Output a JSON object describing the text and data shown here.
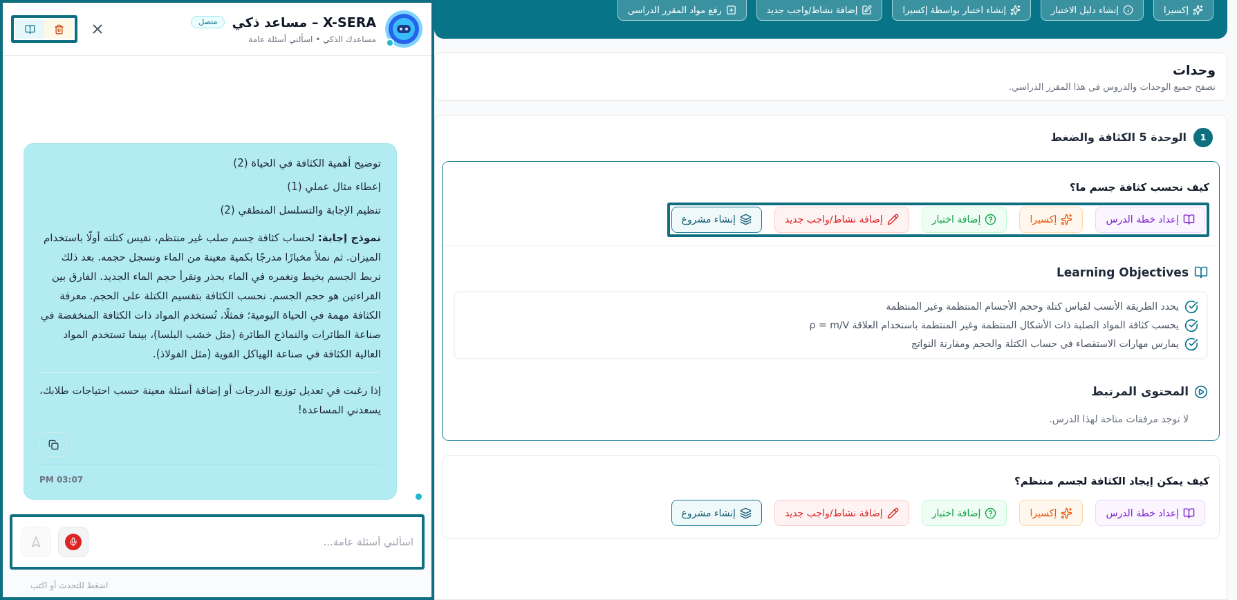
{
  "top_actions": [
    {
      "kind": "xsera",
      "label": "إكسيرا"
    },
    {
      "kind": "guide",
      "label": "إنشاء دليل الاختبار"
    },
    {
      "kind": "ai_quiz",
      "label": "إنشاء اختبار بواسطة إكسيرا"
    },
    {
      "kind": "activity",
      "label": "إضافة نشاط/واجب جديد"
    },
    {
      "kind": "upload",
      "label": "رفع مواد المقرر الدراسي"
    }
  ],
  "units_header": {
    "title": "وحدات",
    "subtitle": "تصفح جميع الوحدات والدروس في هذا المقرر الدراسي."
  },
  "unit": {
    "number": "1",
    "title": "الوحدة 5 الكثافة والضغط",
    "lessons": [
      {
        "title": "كيف نحسب كثافة جسم ما؟",
        "expanded": true,
        "actions": [
          {
            "kind": "plan",
            "label": "إعداد خطة الدرس"
          },
          {
            "kind": "xsera",
            "label": "إكسيرا"
          },
          {
            "kind": "quiz",
            "label": "إضافة اختبار"
          },
          {
            "kind": "activity",
            "label": "إضافة نشاط/واجب جديد"
          },
          {
            "kind": "project",
            "label": "إنشاء مشروع"
          }
        ],
        "objectives": {
          "title": "Learning Objectives",
          "items": [
            "يحدد الطريقة الأنسب لقياس كتلة وحجم الأجسام المنتظمة وغير المنتظمة",
            "يحسب كثافة المواد الصلبة ذات الأشكال المنتظمة وغير المنتظمة باستخدام العلاقة ρ = m/V",
            "يمارس مهارات الاستقصاء في حساب الكتلة والحجم ومقارنة النواتج"
          ]
        },
        "related": {
          "title": "المحتوى المرتبط",
          "empty": "لا توجد مرفقات متاحة لهذا الدرس."
        }
      },
      {
        "title": "كيف يمكن إيجاد الكثافة لجسم منتظم؟",
        "expanded": false,
        "actions": [
          {
            "kind": "plan",
            "label": "إعداد خطة الدرس"
          },
          {
            "kind": "xsera",
            "label": "إكسيرا"
          },
          {
            "kind": "quiz",
            "label": "إضافة اختبار"
          },
          {
            "kind": "activity",
            "label": "إضافة نشاط/واجب جديد"
          },
          {
            "kind": "project",
            "label": "إنشاء مشروع"
          }
        ]
      }
    ]
  },
  "chat": {
    "title": "X-SERA – مساعد ذكي",
    "status": "متصل",
    "subtitle": "مساعدك الذكي • اسألني أسئلة عامة",
    "message": {
      "lines": [
        "توضيح أهمية الكثافة في الحياة (2)",
        "إعطاء مثال عملي (1)",
        "تنظيم الإجابة والتسلسل المنطقي (2)"
      ],
      "answer": "**نموذج إجابة:** لحساب كثافة جسم صلب غير منتظم، نقيس كتلته أولًا باستخدام الميزان. ثم نملأ مخبارًا مدرجًا بكمية معينة من الماء ونسجل حجمه. بعد ذلك نربط الجسم بخيط ونغمره في الماء بحذر ونقرأ حجم الماء الجديد. الفارق بين القراءتين هو حجم الجسم. نحسب الكثافة بتقسيم الكتلة على الحجم. معرفة الكثافة مهمة في الحياة اليومية؛ فمثلًا، تُستخدم المواد ذات الكثافة المنخفضة في صناعة الطائرات والنماذج الطائرة (مثل خشب البلسا)، بينما تستخدم المواد العالية الكثافة في صناعة الهياكل القوية (مثل الفولاذ).",
      "closing": "إذا رغبت في تعديل توزيع الدرجات أو إضافة أسئلة معينة حسب احتياجات طلابك، يسعدني المساعدة!",
      "time": "PM 03:07"
    },
    "input": {
      "placeholder": "اسألني أسئلة عامة..."
    },
    "hint": "اضغط للتحدث أو اكتب"
  }
}
